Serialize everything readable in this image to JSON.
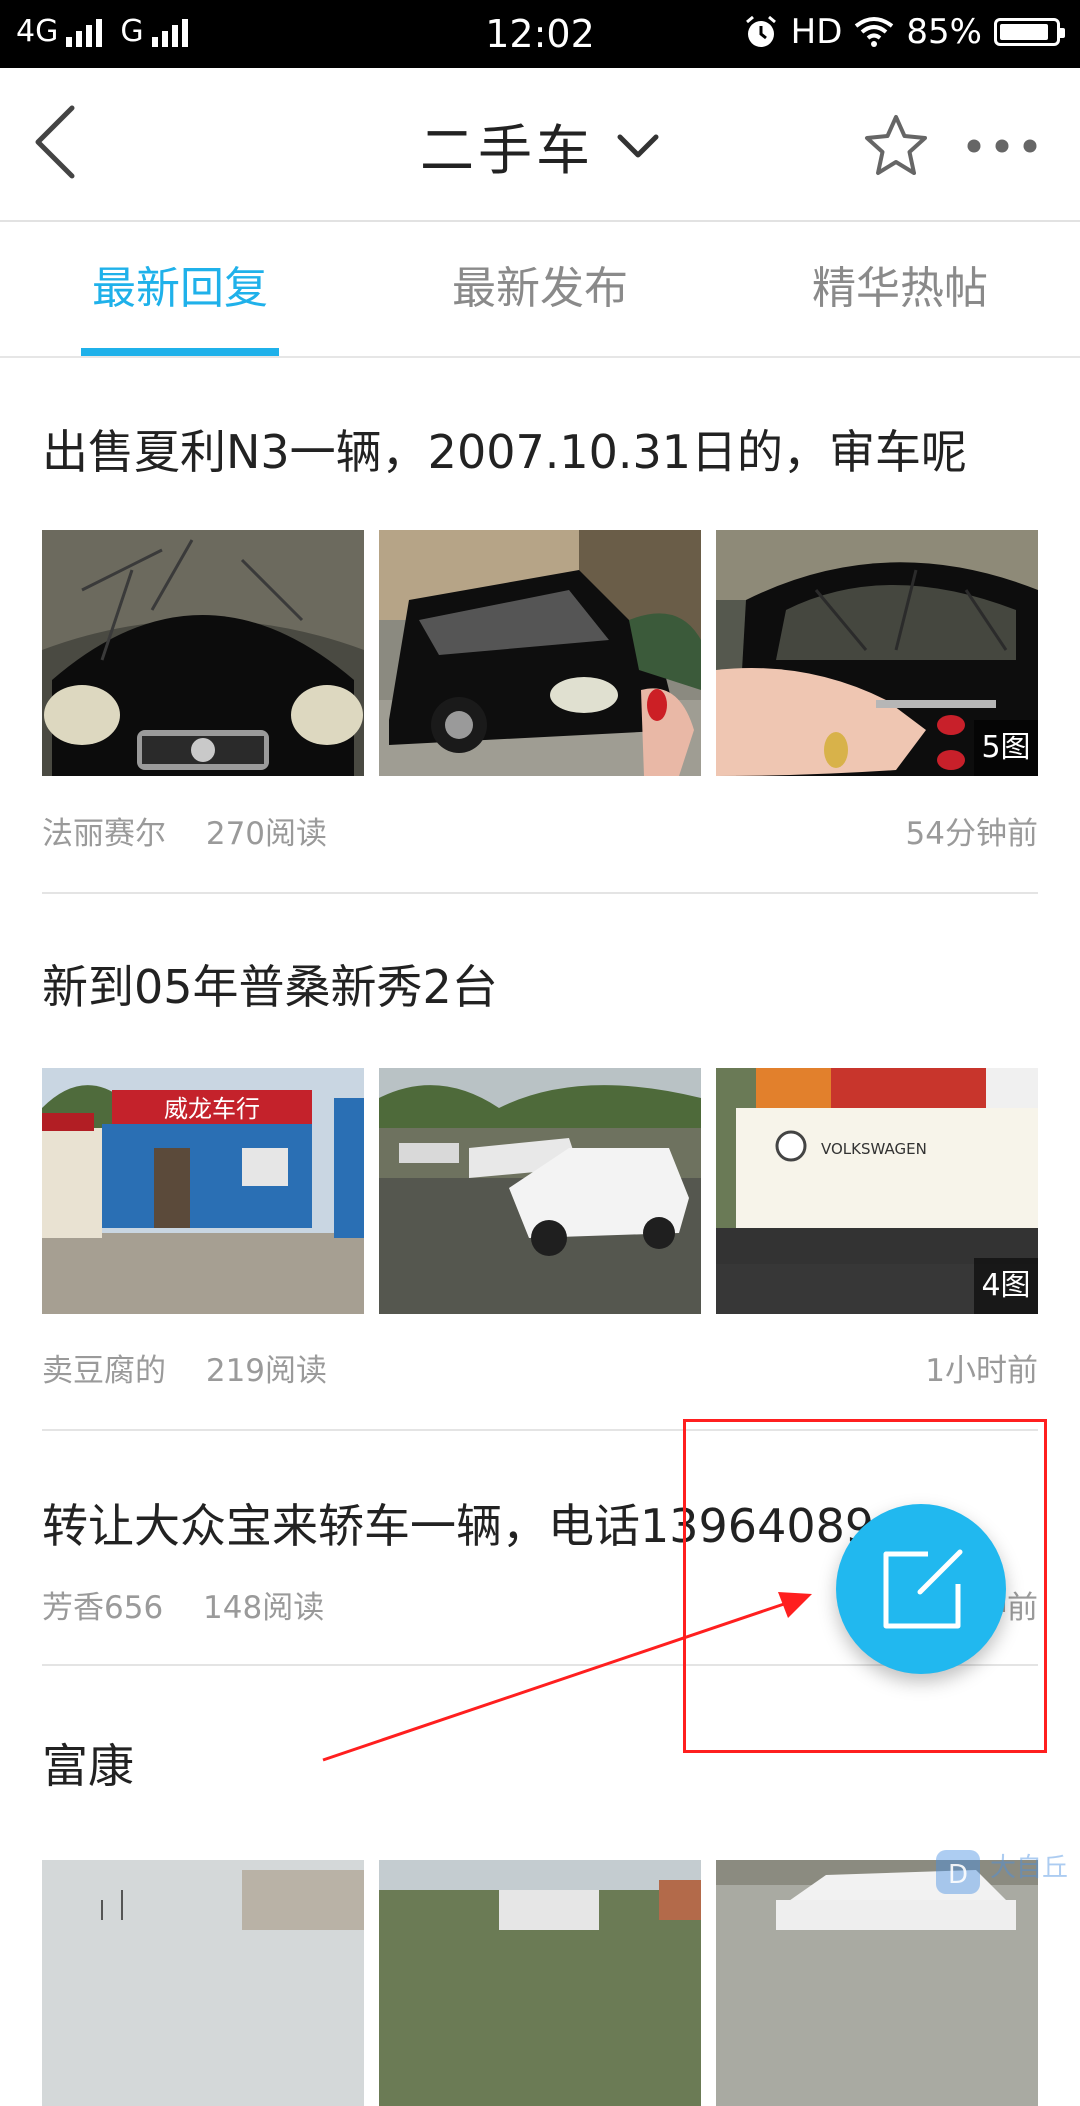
{
  "status_bar": {
    "network1": "4G",
    "network2": "G",
    "time": "12:02",
    "hd": "HD",
    "battery": "85%"
  },
  "header": {
    "title": "二手车",
    "icons": [
      "back-arrow-icon",
      "chevron-down-icon",
      "star-icon",
      "more-icon"
    ]
  },
  "tabs": [
    {
      "label": "最新回复",
      "active": true
    },
    {
      "label": "最新发布",
      "active": false
    },
    {
      "label": "精华热帖",
      "active": false
    }
  ],
  "posts": [
    {
      "title": "出售夏利N3一辆，2007.10.31日的，审车呢",
      "author": "法丽赛尔",
      "reads": "270阅读",
      "time": "54分钟前",
      "image_count": "5图"
    },
    {
      "title": "新到05年普桑新秀2台",
      "author": "卖豆腐的",
      "reads": "219阅读",
      "time": "1小时前",
      "image_count": "4图",
      "sign_text": "威龙车行",
      "logo_text": "VOLKSWAGEN"
    },
    {
      "title": "转让大众宝来轿车一辆，电话13964089",
      "author": "芳香656",
      "reads": "148阅读",
      "time": "钟前"
    },
    {
      "title": "富康"
    }
  ],
  "fab": {
    "icon": "compose-icon"
  },
  "annotation": {
    "box_color": "#ff1f1f",
    "arrow_color": "#ff1f1f"
  },
  "watermark": {
    "text": "大自丘"
  },
  "colors": {
    "accent": "#1fb1ea",
    "status_bar_bg": "#000000"
  }
}
